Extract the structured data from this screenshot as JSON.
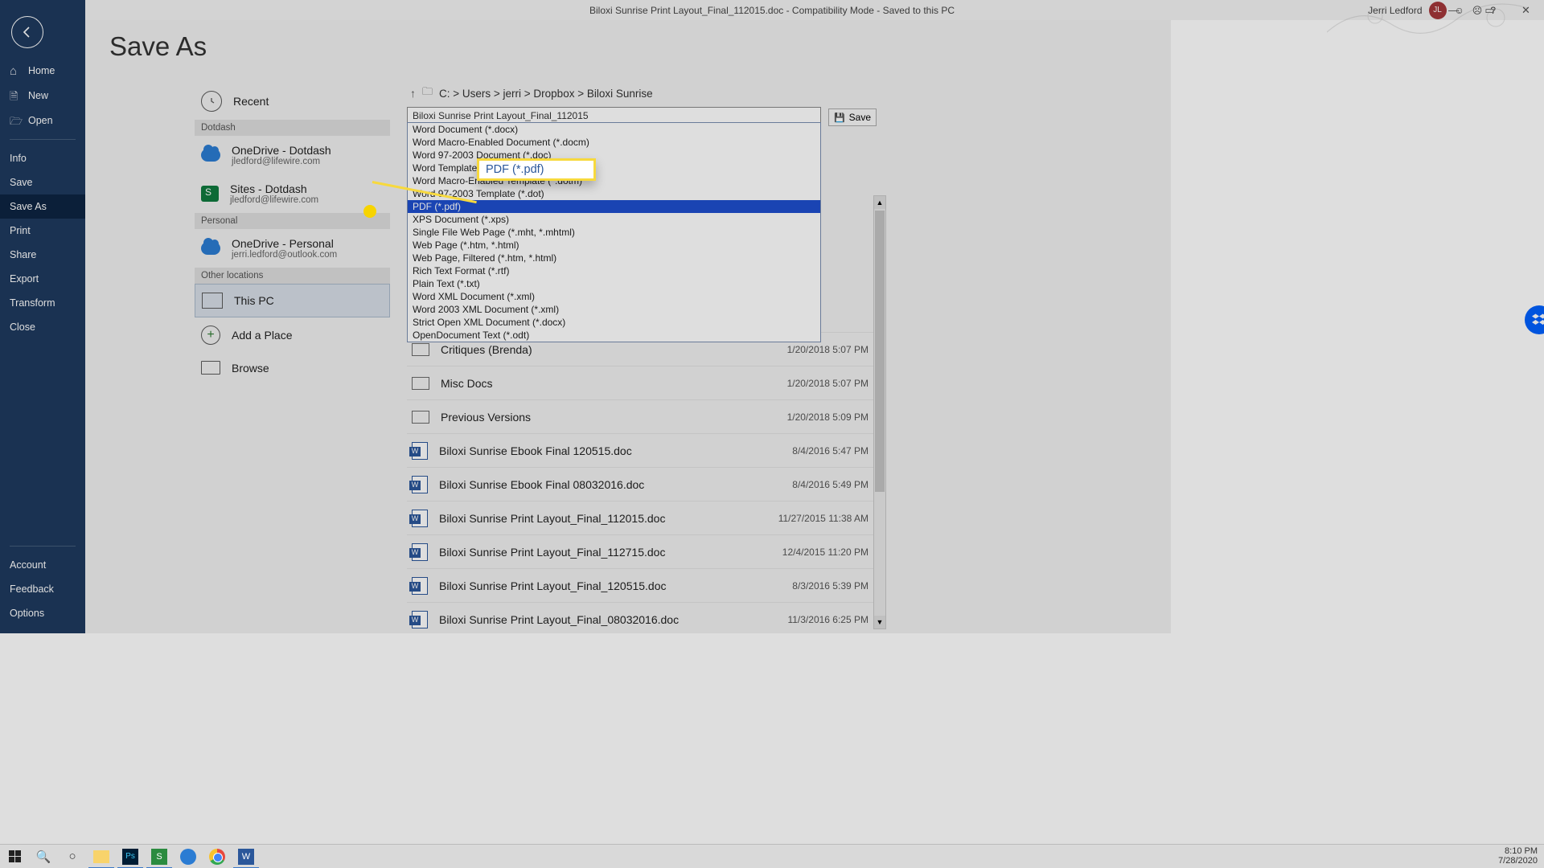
{
  "titlebar": {
    "doc_title": "Biloxi Sunrise Print Layout_Final_112015.doc  -  Compatibility Mode  -  Saved to this PC",
    "user_name": "Jerri Ledford",
    "user_initials": "JL"
  },
  "sidebar": {
    "home": "Home",
    "new": "New",
    "open": "Open",
    "info": "Info",
    "save": "Save",
    "save_as": "Save As",
    "print": "Print",
    "share": "Share",
    "export": "Export",
    "transform": "Transform",
    "close": "Close",
    "account": "Account",
    "feedback": "Feedback",
    "options": "Options"
  },
  "page": {
    "title": "Save As"
  },
  "locations": {
    "recent": "Recent",
    "hdr_dotdash": "Dotdash",
    "onedrive_dotdash": {
      "title": "OneDrive - Dotdash",
      "sub": "jledford@lifewire.com"
    },
    "sites_dotdash": {
      "title": "Sites - Dotdash",
      "sub": "jledford@lifewire.com"
    },
    "hdr_personal": "Personal",
    "onedrive_personal": {
      "title": "OneDrive - Personal",
      "sub": "jerri.ledford@outlook.com"
    },
    "hdr_other": "Other locations",
    "this_pc": "This PC",
    "add_place": "Add a Place",
    "browse": "Browse"
  },
  "filepanel": {
    "breadcrumb": "C: > Users > jerri > Dropbox > Biloxi Sunrise",
    "filename": "Biloxi Sunrise Print Layout_Final_112015",
    "filetype_selected": "Word 97-2003 Document (*.doc)",
    "save_label": "Save",
    "dropdown": [
      "Word Document (*.docx)",
      "Word Macro-Enabled Document (*.docm)",
      "Word 97-2003 Document (*.doc)",
      "Word Template (*.dotx)",
      "Word Macro-Enabled Template (*.dotm)",
      "Word 97-2003 Template (*.dot)",
      "PDF (*.pdf)",
      "XPS Document (*.xps)",
      "Single File Web Page (*.mht, *.mhtml)",
      "Web Page (*.htm, *.html)",
      "Web Page, Filtered (*.htm, *.html)",
      "Rich Text Format (*.rtf)",
      "Plain Text (*.txt)",
      "Word XML Document (*.xml)",
      "Word 2003 XML Document (*.xml)",
      "Strict Open XML Document (*.docx)",
      "OpenDocument Text (*.odt)"
    ],
    "dropdown_selected_index": 6,
    "files": [
      {
        "type": "folder",
        "name": "Critiques (Brenda)",
        "date": "1/20/2018 5:07 PM"
      },
      {
        "type": "folder",
        "name": "Misc Docs",
        "date": "1/20/2018 5:07 PM"
      },
      {
        "type": "folder",
        "name": "Previous Versions",
        "date": "1/20/2018 5:09 PM"
      },
      {
        "type": "word",
        "name": "Biloxi Sunrise Ebook Final 120515.doc",
        "date": "8/4/2016 5:47 PM"
      },
      {
        "type": "word",
        "name": "Biloxi Sunrise Ebook Final 08032016.doc",
        "date": "8/4/2016 5:49 PM"
      },
      {
        "type": "word",
        "name": "Biloxi Sunrise Print Layout_Final_112015.doc",
        "date": "11/27/2015 11:38 AM"
      },
      {
        "type": "word",
        "name": "Biloxi Sunrise Print Layout_Final_112715.doc",
        "date": "12/4/2015 11:20 PM"
      },
      {
        "type": "word",
        "name": "Biloxi Sunrise Print Layout_Final_120515.doc",
        "date": "8/3/2016 5:39 PM"
      },
      {
        "type": "word",
        "name": "Biloxi Sunrise Print Layout_Final_08032016.doc",
        "date": "11/3/2016 6:25 PM"
      }
    ]
  },
  "callout": {
    "text": "PDF (*.pdf)"
  },
  "taskbar": {
    "time": "8:10 PM",
    "date": "7/28/2020"
  }
}
